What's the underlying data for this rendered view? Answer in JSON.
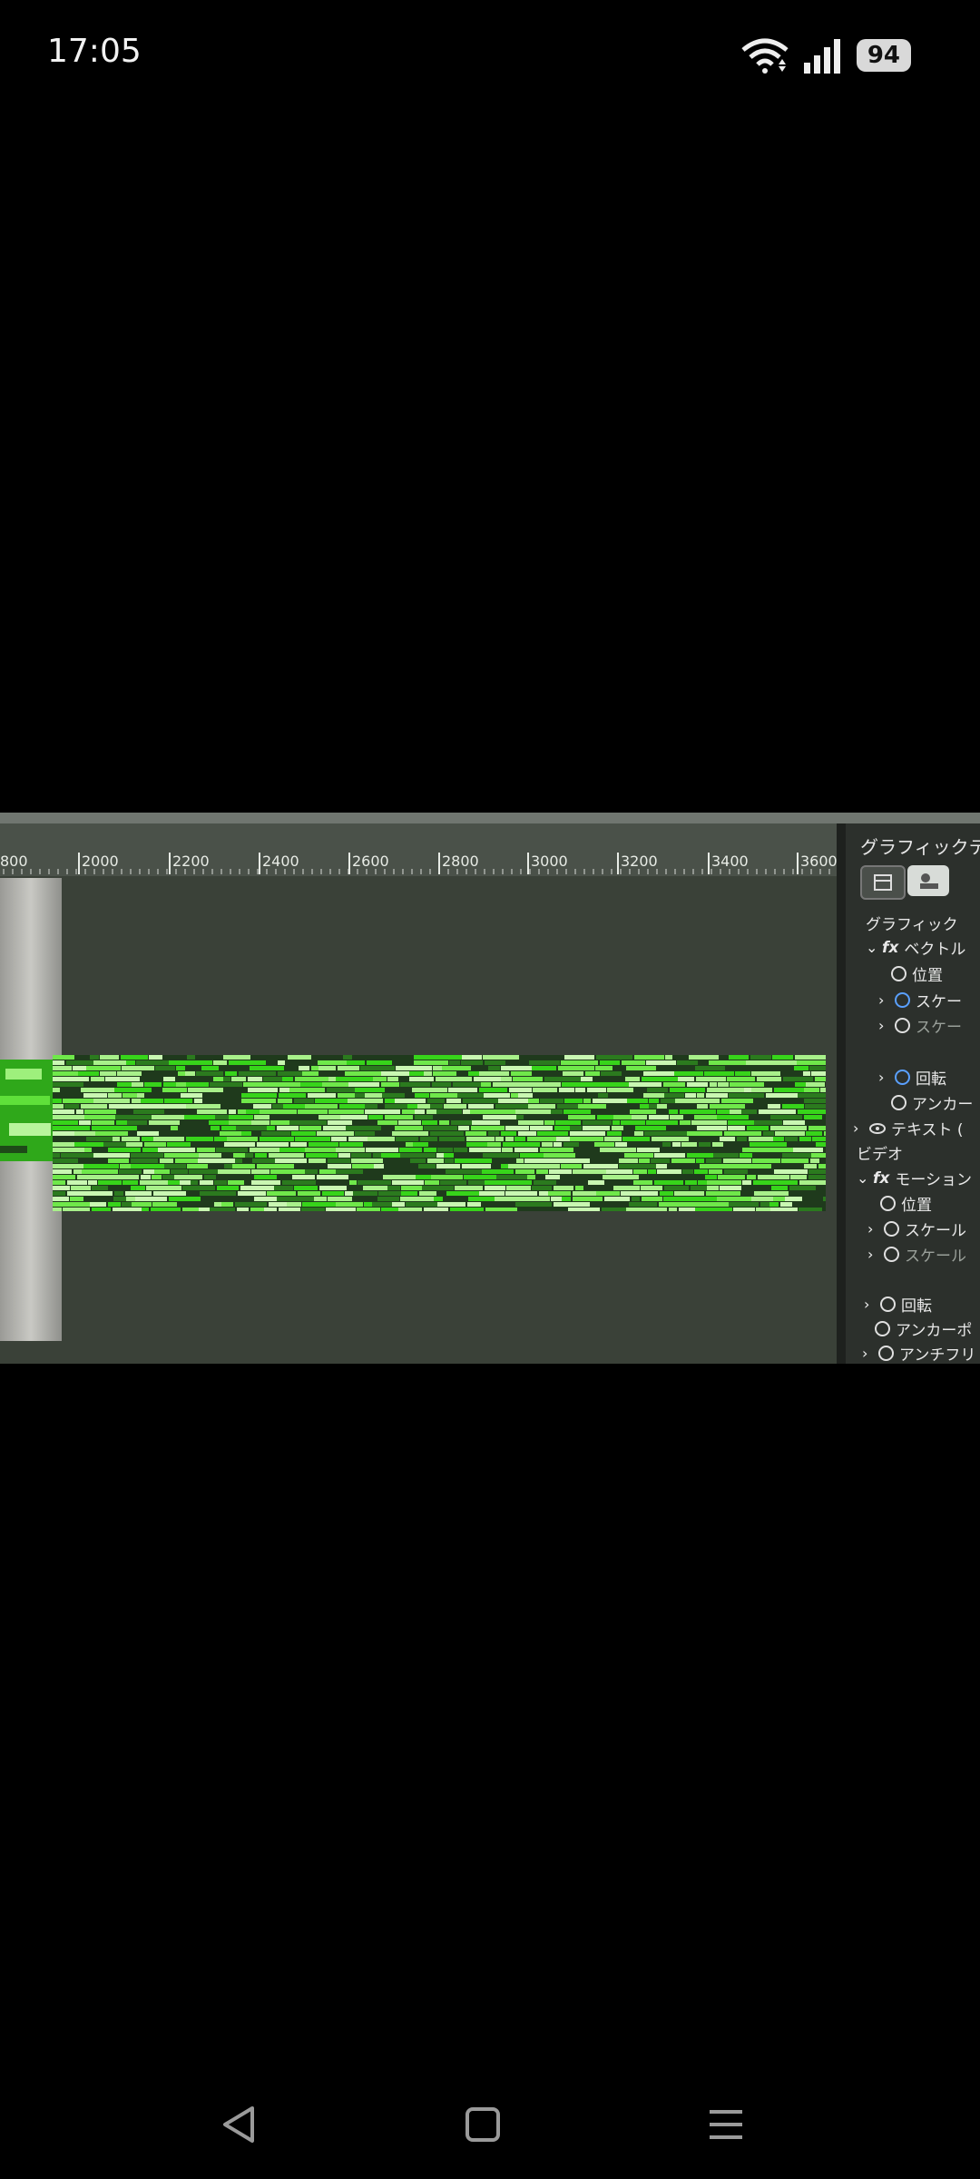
{
  "status_bar": {
    "time": "17:05",
    "battery": "94",
    "icons": [
      "wifi-icon",
      "signal-icon",
      "battery-icon"
    ]
  },
  "photo": {
    "ruler_ticks": [
      "800",
      "2000",
      "2200",
      "2400",
      "2600",
      "2800",
      "3000",
      "3200",
      "3400",
      "3600"
    ],
    "panel": {
      "title": "グラフィックテ",
      "section_graphic": "グラフィック",
      "vector_motion": "ベクトル",
      "graphic_position": "位置",
      "graphic_scale": "スケー",
      "graphic_scale_width": "スケー",
      "graphic_rotation": "回転",
      "graphic_anchor": "アンカー",
      "text_layer": "テキスト (",
      "section_video": "ビデオ",
      "motion": "モーション",
      "video_position": "位置",
      "video_scale": "スケール",
      "video_scale_width": "スケール",
      "video_rotation": "回転",
      "video_anchor": "アンカーポ",
      "video_antiflicker": "アンチフリ"
    }
  },
  "colors": {
    "glitch_green": "#37d41a",
    "glitch_light": "#a8f08a",
    "glitch_dark": "#1f3a1c"
  },
  "navigation": {
    "icons": [
      "back-icon",
      "home-icon",
      "recents-icon"
    ]
  }
}
